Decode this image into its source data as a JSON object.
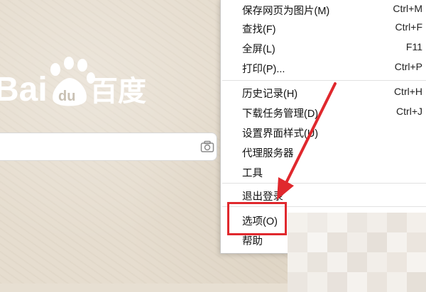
{
  "logo": {
    "text_left": "Bai",
    "text_paw": "du",
    "text_right": "百度"
  },
  "menu": {
    "items": [
      {
        "label": "保存网页为图片(M)",
        "shortcut": "Ctrl+M"
      },
      {
        "label": "查找(F)",
        "shortcut": "Ctrl+F"
      },
      {
        "label": "全屏(L)",
        "shortcut": "F11"
      },
      {
        "label": "打印(P)...",
        "shortcut": "Ctrl+P"
      },
      {
        "label": "历史记录(H)",
        "shortcut": "Ctrl+H"
      },
      {
        "label": "下载任务管理(D)",
        "shortcut": "Ctrl+J"
      },
      {
        "label": "设置界面样式(U)",
        "shortcut": ""
      },
      {
        "label": "代理服务器",
        "shortcut": "",
        "submenu_arrow": "›"
      },
      {
        "label": "工具",
        "shortcut": "",
        "submenu_arrow": "›"
      },
      {
        "label": "退出登录",
        "shortcut": ""
      },
      {
        "label": "选项(O)",
        "shortcut": ""
      },
      {
        "label": "帮助",
        "shortcut": "",
        "submenu_arrow": "›"
      }
    ]
  },
  "annotation": {
    "highlight_color": "#e0282d"
  },
  "colors": {
    "background": "#e6ddcf",
    "logo_white": "#ffffff",
    "menu_bg": "#ffffff"
  }
}
